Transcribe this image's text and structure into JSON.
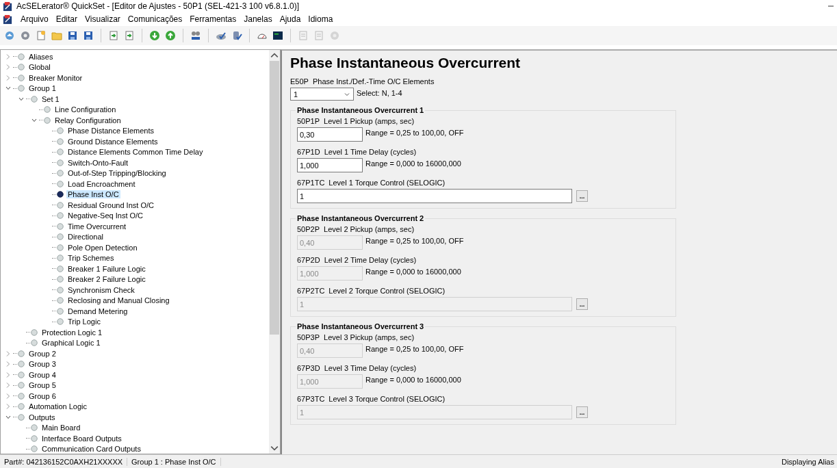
{
  "window": {
    "title": "AcSELerator® QuickSet - [Editor de Ajustes - 50P1 (SEL-421-3 100 v6.8.1.0)]"
  },
  "menu": [
    "Arquivo",
    "Editar",
    "Visualizar",
    "Comunicações",
    "Ferramentas",
    "Janelas",
    "Ajuda",
    "Idioma"
  ],
  "tree": [
    {
      "label": "Aliases",
      "expanded": false,
      "selected": false
    },
    {
      "label": "Global",
      "expanded": false,
      "selected": false
    },
    {
      "label": "Breaker Monitor",
      "expanded": false,
      "selected": false
    },
    {
      "label": "Group 1",
      "expanded": true,
      "selected": false,
      "children": [
        {
          "label": "Set 1",
          "expanded": true,
          "selected": false,
          "children": [
            {
              "label": "Line Configuration",
              "selected": false
            },
            {
              "label": "Relay Configuration",
              "expanded": true,
              "selected": false,
              "children": [
                {
                  "label": "Phase Distance Elements",
                  "selected": false
                },
                {
                  "label": "Ground Distance Elements",
                  "selected": false
                },
                {
                  "label": "Distance Elements Common Time Delay",
                  "selected": false
                },
                {
                  "label": "Switch-Onto-Fault",
                  "selected": false
                },
                {
                  "label": "Out-of-Step Tripping/Blocking",
                  "selected": false
                },
                {
                  "label": "Load Encroachment",
                  "selected": false
                },
                {
                  "label": "Phase Inst O/C",
                  "selected": true
                },
                {
                  "label": "Residual Ground Inst O/C",
                  "selected": false
                },
                {
                  "label": "Negative-Seq Inst O/C",
                  "selected": false
                },
                {
                  "label": "Time Overcurrent",
                  "selected": false
                },
                {
                  "label": "Directional",
                  "selected": false
                },
                {
                  "label": "Pole Open Detection",
                  "selected": false
                },
                {
                  "label": "Trip Schemes",
                  "selected": false
                },
                {
                  "label": "Breaker 1 Failure Logic",
                  "selected": false
                },
                {
                  "label": "Breaker 2 Failure Logic",
                  "selected": false
                },
                {
                  "label": "Synchronism Check",
                  "selected": false
                },
                {
                  "label": "Reclosing and Manual Closing",
                  "selected": false
                },
                {
                  "label": "Demand Metering",
                  "selected": false
                },
                {
                  "label": "Trip Logic",
                  "selected": false
                }
              ]
            }
          ]
        },
        {
          "label": "Protection Logic 1",
          "selected": false
        },
        {
          "label": "Graphical Logic 1",
          "selected": false
        }
      ]
    },
    {
      "label": "Group 2",
      "expanded": false,
      "selected": false
    },
    {
      "label": "Group 3",
      "expanded": false,
      "selected": false
    },
    {
      "label": "Group 4",
      "expanded": false,
      "selected": false
    },
    {
      "label": "Group 5",
      "expanded": false,
      "selected": false
    },
    {
      "label": "Group 6",
      "expanded": false,
      "selected": false
    },
    {
      "label": "Automation Logic",
      "expanded": false,
      "selected": false
    },
    {
      "label": "Outputs",
      "expanded": true,
      "selected": false,
      "children": [
        {
          "label": "Main Board",
          "selected": false
        },
        {
          "label": "Interface Board Outputs",
          "selected": false
        },
        {
          "label": "Communication Card Outputs",
          "selected": false
        }
      ]
    }
  ],
  "editor": {
    "heading": "Phase Instantaneous Overcurrent",
    "selector": {
      "code": "E50P",
      "label": "Phase Inst./Def.-Time O/C Elements",
      "value": "1",
      "hint": "Select: N, 1-4"
    },
    "groups": [
      {
        "title": "Phase Instantaneous Overcurrent 1",
        "fields": [
          {
            "kind": "short",
            "code": "50P1P",
            "label": "Level 1 Pickup (amps, sec)",
            "value": "0,30",
            "range": "Range = 0,25 to 100,00, OFF",
            "disabled": false
          },
          {
            "kind": "short",
            "code": "67P1D",
            "label": "Level 1 Time Delay (cycles)",
            "value": "1,000",
            "range": "Range = 0,000 to 16000,000",
            "disabled": false
          },
          {
            "kind": "long",
            "code": "67P1TC",
            "label": "Level 1 Torque Control (SELOGIC)",
            "value": "1",
            "button": "...",
            "disabled": false
          }
        ]
      },
      {
        "title": "Phase Instantaneous Overcurrent 2",
        "fields": [
          {
            "kind": "short",
            "code": "50P2P",
            "label": "Level 2 Pickup (amps, sec)",
            "value": "0,40",
            "range": "Range = 0,25 to 100,00, OFF",
            "disabled": true
          },
          {
            "kind": "short",
            "code": "67P2D",
            "label": "Level 2 Time Delay (cycles)",
            "value": "1,000",
            "range": "Range = 0,000 to 16000,000",
            "disabled": true
          },
          {
            "kind": "long",
            "code": "67P2TC",
            "label": "Level 2 Torque Control (SELOGIC)",
            "value": "1",
            "button": "...",
            "disabled": true
          }
        ]
      },
      {
        "title": "Phase Instantaneous Overcurrent 3",
        "fields": [
          {
            "kind": "short",
            "code": "50P3P",
            "label": "Level 3 Pickup (amps, sec)",
            "value": "0,40",
            "range": "Range = 0,25 to 100,00, OFF",
            "disabled": true
          },
          {
            "kind": "short",
            "code": "67P3D",
            "label": "Level 3 Time Delay (cycles)",
            "value": "1,000",
            "range": "Range = 0,000 to 16000,000",
            "disabled": true
          },
          {
            "kind": "long",
            "code": "67P3TC",
            "label": "Level 3 Torque Control (SELOGIC)",
            "value": "1",
            "button": "...",
            "disabled": true
          }
        ]
      }
    ]
  },
  "status_bar": {
    "part": "Part#: 042136152C0AXH21XXXXX",
    "location": "Group 1 : Phase Inst O/C",
    "mode": "Displaying Alias"
  }
}
